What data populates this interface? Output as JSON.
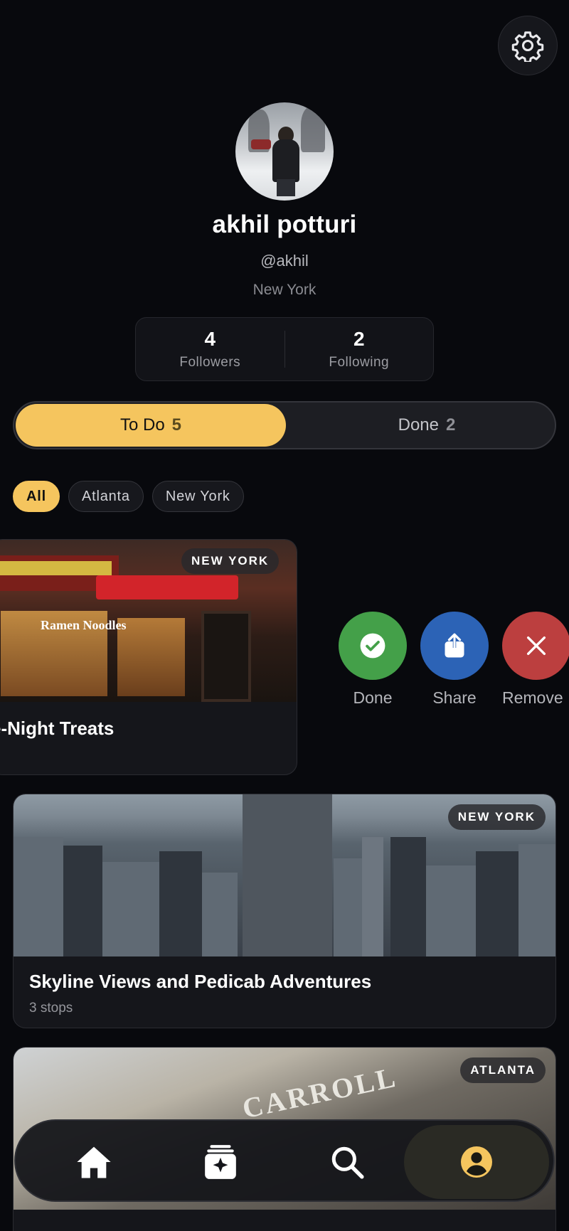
{
  "profile": {
    "name": "akhil potturi",
    "handle": "@akhil",
    "city": "New York",
    "followers_count": "4",
    "followers_label": "Followers",
    "following_count": "2",
    "following_label": "Following"
  },
  "segment": {
    "todo_label": "To Do",
    "todo_count": "5",
    "done_label": "Done",
    "done_count": "2"
  },
  "filters": [
    "All",
    "Atlanta",
    "New York"
  ],
  "cards": [
    {
      "badge": "NEW YORK",
      "title": "e-Night Treats",
      "shop_text": "Ramen Noodles"
    },
    {
      "badge": "NEW YORK",
      "title": "Skyline Views and Pedicab Adventures",
      "subtitle": "3 stops"
    },
    {
      "badge": "ATLANTA",
      "sign_text": "CARROLL"
    }
  ],
  "swipe_actions": {
    "done": "Done",
    "share": "Share",
    "remove": "Remove"
  },
  "colors": {
    "accent": "#f5c55e",
    "done": "#44a049",
    "share": "#2c63b6",
    "remove": "#bc3f3f"
  },
  "nav": {
    "items": [
      "home-icon",
      "create-icon",
      "search-icon",
      "profile-icon"
    ],
    "active": "profile"
  }
}
